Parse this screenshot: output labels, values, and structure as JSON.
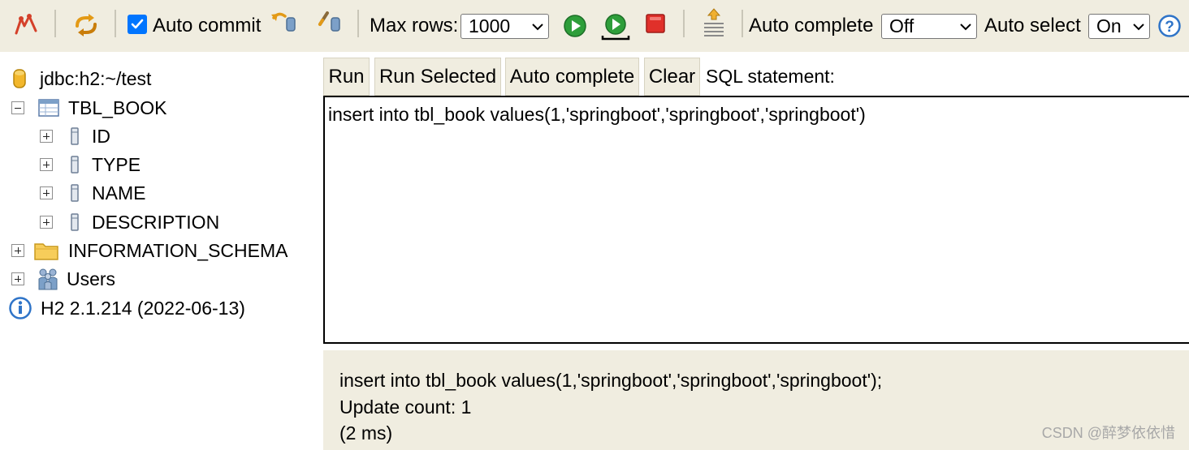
{
  "toolbar": {
    "auto_commit_label": "Auto commit",
    "auto_commit_checked": true,
    "max_rows_label": "Max rows:",
    "max_rows_value": "1000",
    "auto_complete_label": "Auto complete",
    "auto_complete_value": "Off",
    "auto_select_label": "Auto select",
    "auto_select_value": "On",
    "help_glyph": "?",
    "icons": [
      "disconnect-icon",
      "refresh-icon",
      "rollback-icon",
      "commit-icon",
      "run-icon",
      "run-selected-icon",
      "stop-icon",
      "history-icon",
      "help-icon"
    ]
  },
  "tree": {
    "connection": "jdbc:h2:~/test",
    "table": "TBL_BOOK",
    "columns": [
      "ID",
      "TYPE",
      "NAME",
      "DESCRIPTION"
    ],
    "schema": "INFORMATION_SCHEMA",
    "users": "Users",
    "version": "H2 2.1.214 (2022-06-13)"
  },
  "buttons": {
    "run": "Run",
    "run_selected": "Run Selected",
    "auto_complete": "Auto complete",
    "clear": "Clear"
  },
  "sql_label": "SQL statement:",
  "editor_text": "insert into tbl_book values(1,'springboot','springboot','springboot')",
  "result": {
    "statement": "insert into tbl_book values(1,'springboot','springboot','springboot');",
    "update_count": "Update count: 1",
    "time": "(2 ms)"
  },
  "watermark": "CSDN @醉梦依依惜",
  "colors": {
    "toolbar_bg": "#f0ede0",
    "checkbox_blue": "#0075ff",
    "run_green": "#2e9e3a",
    "stop_red": "#e0302a",
    "help_blue": "#2f74c8"
  }
}
